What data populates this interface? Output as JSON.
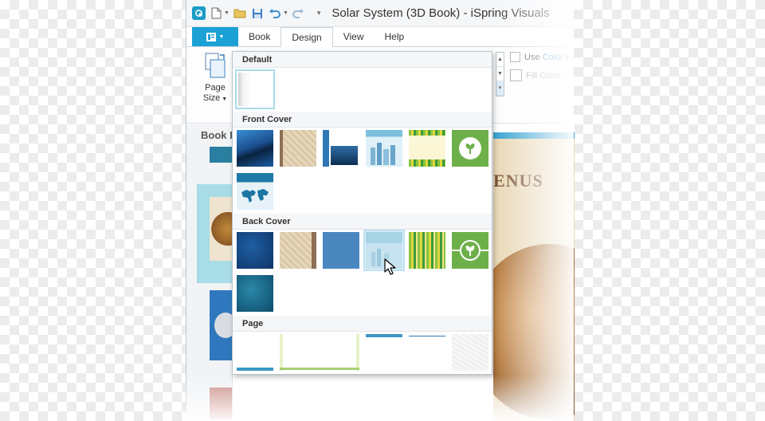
{
  "window": {
    "title": "Solar System (3D Book) - iSpring Visuals"
  },
  "ribbon_tabs": [
    {
      "label": "Book",
      "active": false
    },
    {
      "label": "Design",
      "active": true
    },
    {
      "label": "View",
      "active": false
    },
    {
      "label": "Help",
      "active": false
    }
  ],
  "ribbon": {
    "page_size_label": "Page",
    "page_size_label2": "Size",
    "use_color_fill_label": "Use ",
    "use_color_fill_label_accent": "Color Fi",
    "fill_color_label": "Fill Color..."
  },
  "left_panel": {
    "header": "Book P"
  },
  "canvas": {
    "page_heading": "ENUS"
  },
  "gallery": {
    "sections": {
      "default": "Default",
      "front_cover": "Front Cover",
      "back_cover": "Back Cover",
      "page": "Page"
    },
    "hovered_item": "back-cover-skyline",
    "selected_item": "default-blank"
  },
  "colors": {
    "accent": "#1ba1d6",
    "hover": "#bfe1f2",
    "selection": "#a8dcea"
  }
}
